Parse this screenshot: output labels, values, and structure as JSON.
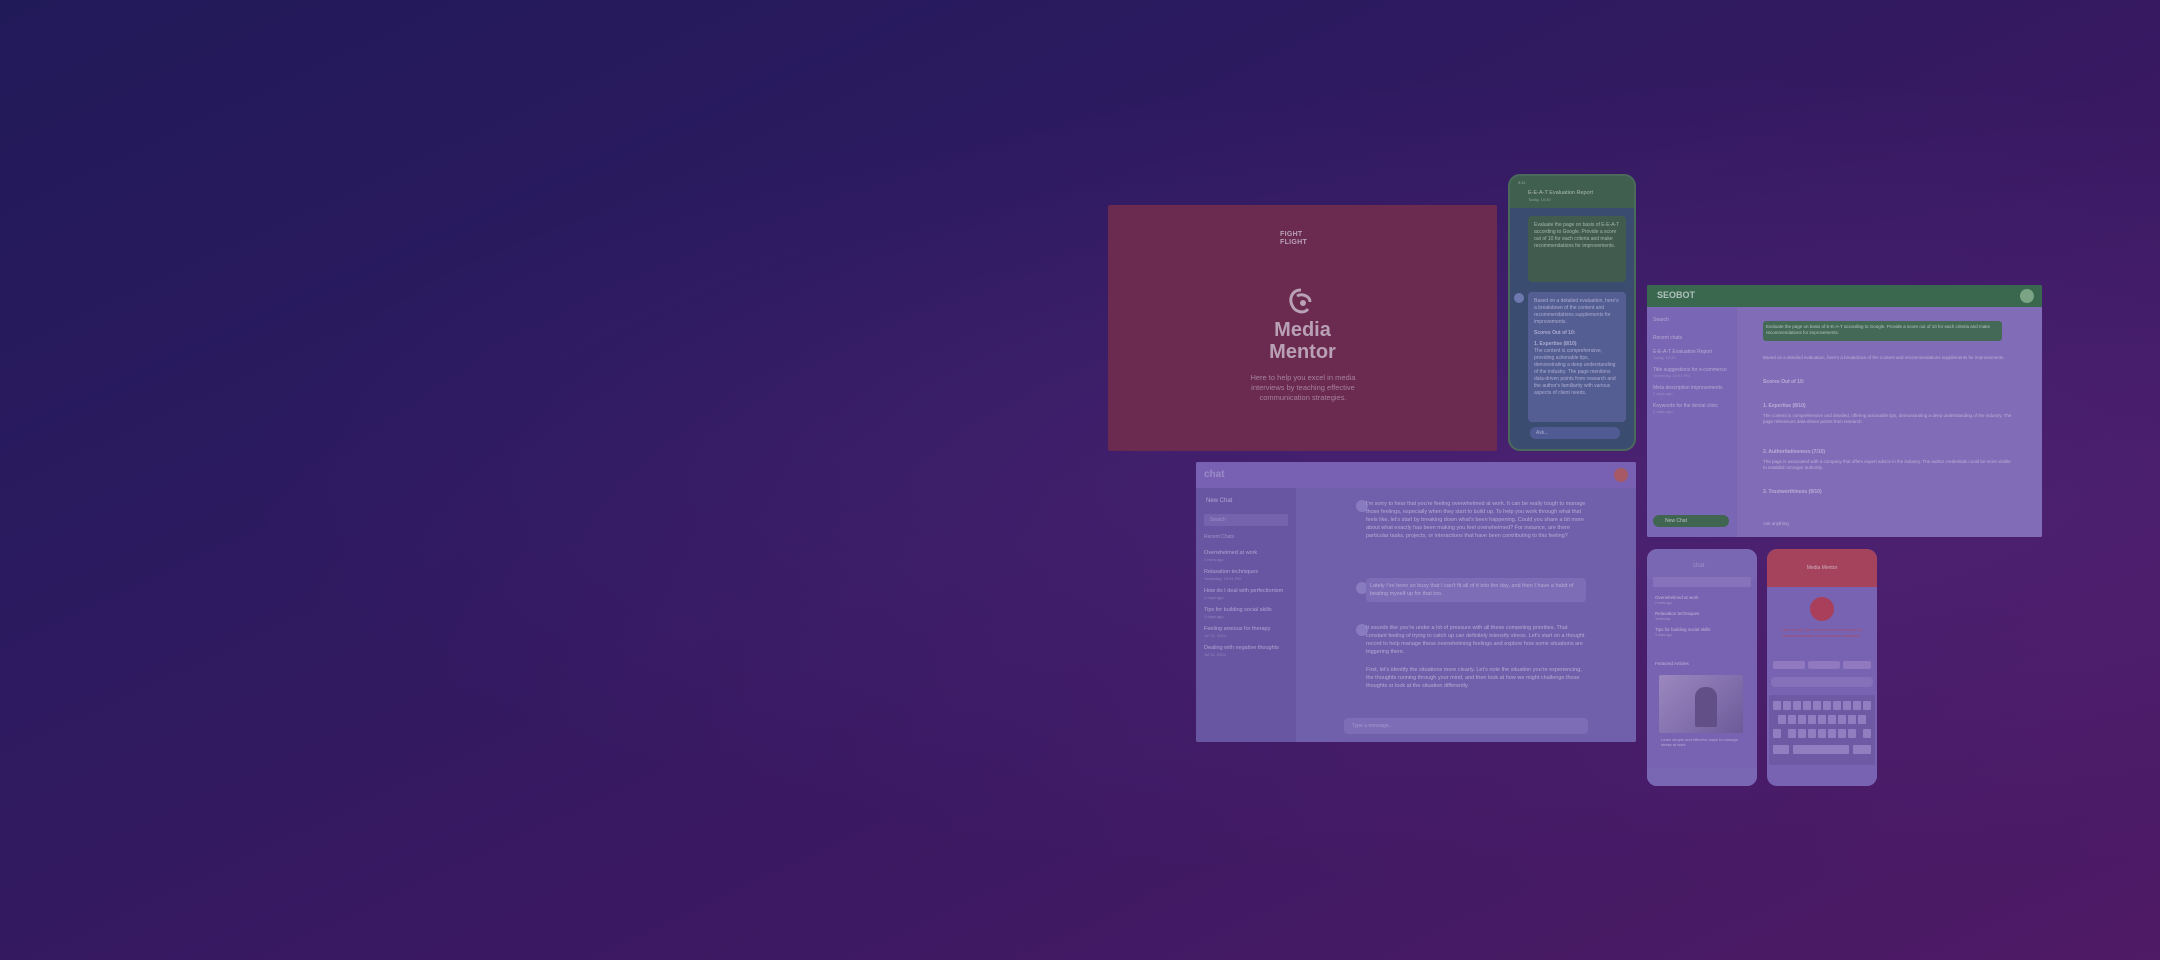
{
  "media_mentor": {
    "brand_line1": "FIGHT",
    "brand_line2": "FLIGHT",
    "title_line1": "Media",
    "title_line2": "Mentor",
    "description": "Here to help you excel in media interviews by teaching effective communication strategies."
  },
  "phone_green": {
    "status": "9:41",
    "title": "E-E-A-T Evaluation Report",
    "subtitle": "Today, 10:30",
    "bubble_user": "Evaluate the page on basis of E-E-A-T according to Google. Provide a score out of 10 for each criteria and make recommendations for improvements.",
    "bubble_bot": "Based on a detailed evaluation, here's a breakdown of the content and recommendations supplements for improvements.",
    "score_label": "Scores Out of 10:",
    "point1_title": "1. Expertise (8/10)",
    "point1_text": "The content is comprehensive, providing actionable tips, demonstrating a deep understanding of the industry. The page mentions data-driven points from research and the author's familiarity with various aspects of client needs.",
    "input_placeholder": "Ask..."
  },
  "desktop_app": {
    "logo": "chat",
    "new_chat": "New Chat",
    "search_placeholder": "Search",
    "recent_label": "Recent Chats",
    "recent": [
      {
        "title": "Overwhelmed at work",
        "sub": "2 mins ago"
      },
      {
        "title": "Relaxation techniques",
        "sub": "Yesterday, 10:51 PM"
      },
      {
        "title": "How do I deal with perfectionism",
        "sub": "2 days ago"
      },
      {
        "title": "Tips for building social skills",
        "sub": "3 days ago"
      },
      {
        "title": "Feeling anxious for therapy",
        "sub": "Jul 31, 2024"
      },
      {
        "title": "Dealing with negative thoughts",
        "sub": "Jul 31, 2024"
      }
    ],
    "msg1": "I'm sorry to hear that you're feeling overwhelmed at work. It can be really tough to manage those feelings, especially when they start to build up. To help you work through what that feels like, let's start by breaking down what's been happening. Could you share a bit more about what exactly has been making you feel overwhelmed? For instance, are there particular tasks, projects, or interactions that have been contributing to this feeling?",
    "msg2": "Lately I've been so busy that I can't fit all of it into the day, and then I have a habit of beating myself up for that too.",
    "msg3": "It sounds like you're under a lot of pressure with all these competing priorities. That constant feeling of trying to catch up can definitely intensify stress. Let's start on a thought record to help manage these overwhelming feelings and explore how some situations are triggering them.",
    "msg4": "First, let's identify the situations more clearly. Let's note the situation you're experiencing, the thoughts running through your mind, and then look at how we might challenge those thoughts or look at the situation differently.",
    "input_placeholder": "Type a message..."
  },
  "seo_app": {
    "logo": "SEOBOT",
    "search": "Search",
    "recent_label": "Recent chats",
    "recent": [
      {
        "title": "E-E-A-T Evaluation Report",
        "sub": "Today, 10:30"
      },
      {
        "title": "Title suggestions for e-commerce",
        "sub": "Yesterday, 10:51 PM"
      },
      {
        "title": "Meta description improvements",
        "sub": "2 days ago"
      },
      {
        "title": "Keywords for the dental clinic",
        "sub": "3 days ago"
      }
    ],
    "new_chat": "New Chat",
    "user_msg": "Evaluate the page on basis of E-E-A-T according to Google. Provide a score out of 10 for each criteria and make recommendations for improvements.",
    "bot_intro": "Based on a detailed evaluation, here's a breakdown of the content and recommendations supplements for improvements.",
    "scores_label": "Scores Out of 10:",
    "expertise_title": "1. Expertise (8/10)",
    "expertise_text": "The content is comprehensive and detailed, offering actionable tips, demonstrating a deep understanding of the industry. The page references data-driven points from research.",
    "auth_title": "2. Authoritativeness (7/10)",
    "auth_text": "The page is associated with a company that offers expert advice in the industry. The author credentials could be more visible to establish stronger authority.",
    "trust_title": "3. Trustworthiness (9/10)",
    "footer_hint": "Ask anything"
  },
  "phone_purple": {
    "logo": "chat",
    "items": [
      {
        "title": "Overwhelmed at work",
        "sub": "2 mins ago"
      },
      {
        "title": "Relaxation techniques",
        "sub": "Yesterday"
      },
      {
        "title": "Tips for building social skills",
        "sub": "3 days ago"
      }
    ],
    "featured_label": "Featured Articles",
    "caption": "Learn simple and effective ways to manage stress at work"
  },
  "phone_red": {
    "title": "Media Mentor",
    "prompt": "Here to help you excel in media interviews by teaching effective communication strategies."
  }
}
